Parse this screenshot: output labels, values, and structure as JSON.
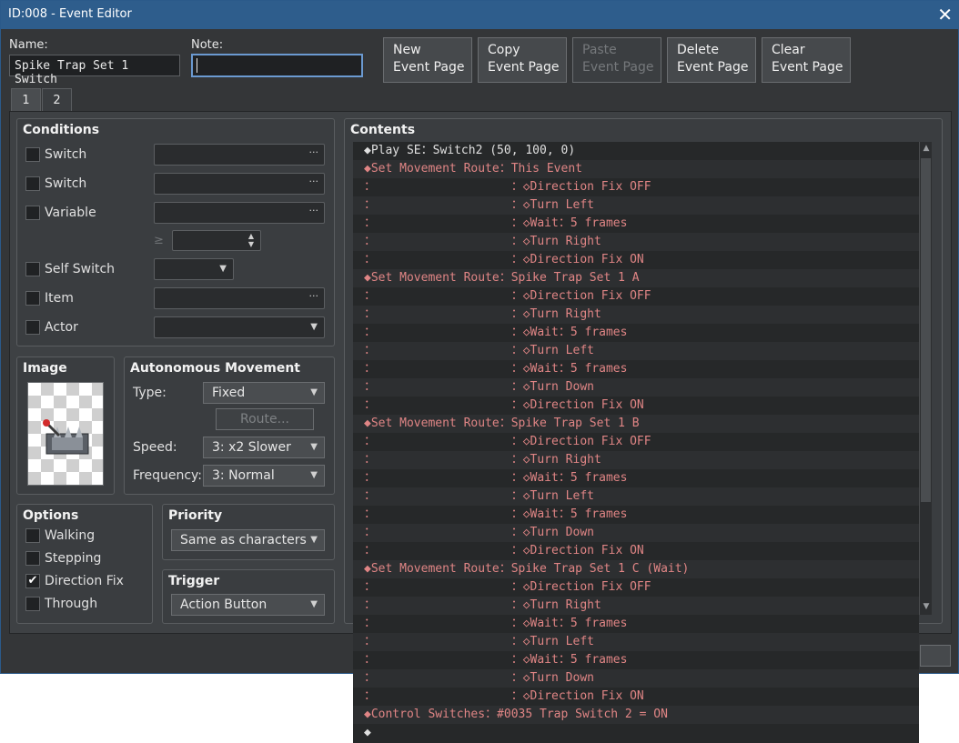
{
  "window": {
    "title": "ID:008 - Event Editor"
  },
  "form": {
    "name_label": "Name:",
    "name_value": "Spike Trap Set 1 Switch",
    "note_label": "Note:",
    "note_value": ""
  },
  "toolbar": {
    "new": "New\nEvent Page",
    "copy": "Copy\nEvent Page",
    "paste": "Paste\nEvent Page",
    "delete": "Delete\nEvent Page",
    "clear": "Clear\nEvent Page"
  },
  "tabs": [
    "1",
    "2"
  ],
  "conditions": {
    "title": "Conditions",
    "switch1": "Switch",
    "switch2": "Switch",
    "variable": "Variable",
    "ge": "≥",
    "self_switch": "Self Switch",
    "item": "Item",
    "actor": "Actor"
  },
  "image": {
    "title": "Image"
  },
  "autonomous": {
    "title": "Autonomous Movement",
    "type_label": "Type:",
    "type_value": "Fixed",
    "route_button": "Route...",
    "speed_label": "Speed:",
    "speed_value": "3: x2 Slower",
    "frequency_label": "Frequency:",
    "frequency_value": "3: Normal"
  },
  "options": {
    "title": "Options",
    "walking": "Walking",
    "stepping": "Stepping",
    "direction_fix": "Direction Fix",
    "through": "Through"
  },
  "priority": {
    "title": "Priority",
    "value": "Same as characters"
  },
  "trigger": {
    "title": "Trigger",
    "value": "Action Button"
  },
  "contents": {
    "title": "Contents",
    "rows": [
      {
        "text": "◆Play SE：Switch2 (50, 100, 0)",
        "kind": "play"
      },
      {
        "text": "◆Set Movement Route：This Event",
        "kind": "route"
      },
      {
        "text": "：                   ：◇Direction Fix OFF",
        "kind": "route"
      },
      {
        "text": "：                   ：◇Turn Left",
        "kind": "route"
      },
      {
        "text": "：                   ：◇Wait：5 frames",
        "kind": "route"
      },
      {
        "text": "：                   ：◇Turn Right",
        "kind": "route"
      },
      {
        "text": "：                   ：◇Direction Fix ON",
        "kind": "route"
      },
      {
        "text": "◆Set Movement Route：Spike Trap Set 1 A",
        "kind": "route"
      },
      {
        "text": "：                   ：◇Direction Fix OFF",
        "kind": "route"
      },
      {
        "text": "：                   ：◇Turn Right",
        "kind": "route"
      },
      {
        "text": "：                   ：◇Wait：5 frames",
        "kind": "route"
      },
      {
        "text": "：                   ：◇Turn Left",
        "kind": "route"
      },
      {
        "text": "：                   ：◇Wait：5 frames",
        "kind": "route"
      },
      {
        "text": "：                   ：◇Turn Down",
        "kind": "route"
      },
      {
        "text": "：                   ：◇Direction Fix ON",
        "kind": "route"
      },
      {
        "text": "◆Set Movement Route：Spike Trap Set 1 B",
        "kind": "route"
      },
      {
        "text": "：                   ：◇Direction Fix OFF",
        "kind": "route"
      },
      {
        "text": "：                   ：◇Turn Right",
        "kind": "route"
      },
      {
        "text": "：                   ：◇Wait：5 frames",
        "kind": "route"
      },
      {
        "text": "：                   ：◇Turn Left",
        "kind": "route"
      },
      {
        "text": "：                   ：◇Wait：5 frames",
        "kind": "route"
      },
      {
        "text": "：                   ：◇Turn Down",
        "kind": "route"
      },
      {
        "text": "：                   ：◇Direction Fix ON",
        "kind": "route"
      },
      {
        "text": "◆Set Movement Route：Spike Trap Set 1 C (Wait)",
        "kind": "route"
      },
      {
        "text": "：                   ：◇Direction Fix OFF",
        "kind": "route"
      },
      {
        "text": "：                   ：◇Turn Right",
        "kind": "route"
      },
      {
        "text": "：                   ：◇Wait：5 frames",
        "kind": "route"
      },
      {
        "text": "：                   ：◇Turn Left",
        "kind": "route"
      },
      {
        "text": "：                   ：◇Wait：5 frames",
        "kind": "route"
      },
      {
        "text": "：                   ：◇Turn Down",
        "kind": "route"
      },
      {
        "text": "：                   ：◇Direction Fix ON",
        "kind": "route"
      },
      {
        "text": "◆Control Switches：#0035 Trap Switch 2 = ON",
        "kind": "route"
      },
      {
        "text": "◆",
        "kind": "play"
      }
    ]
  },
  "colors": {
    "titlebar": "#2e5d8c",
    "panel": "#3a3d40",
    "command_red": "#e08585"
  }
}
